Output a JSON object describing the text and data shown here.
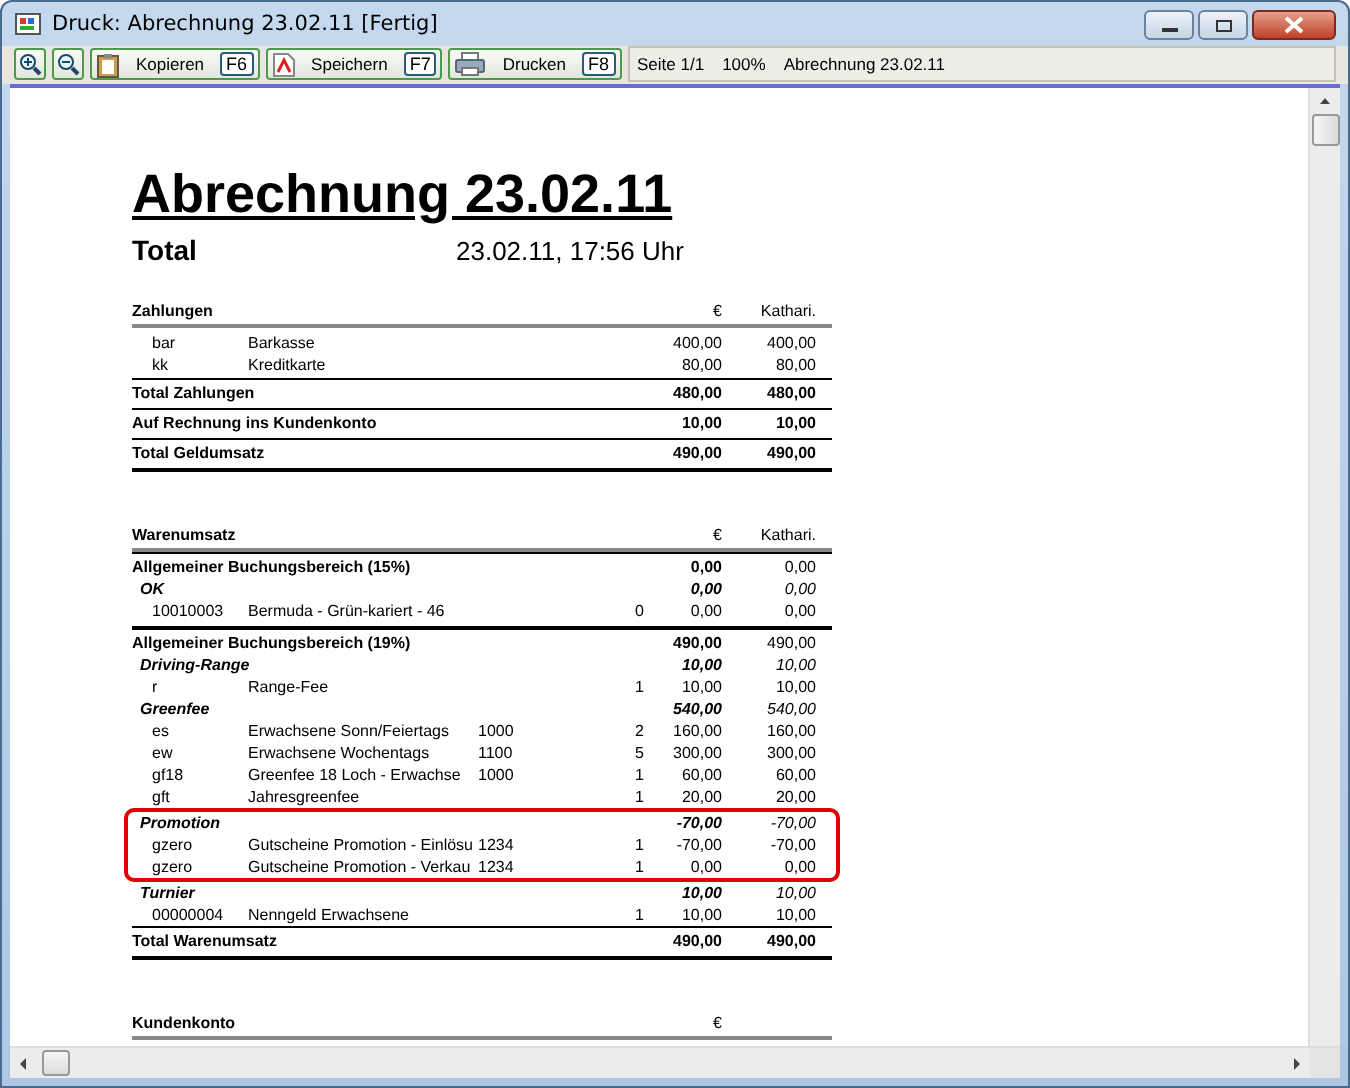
{
  "window": {
    "title": "Druck: Abrechnung 23.02.11 [Fertig]"
  },
  "toolbar": {
    "buttons": [
      {
        "kind": "copy",
        "label": "Kopieren",
        "key": "F6"
      },
      {
        "kind": "save",
        "label": "Speichern",
        "key": "F7"
      },
      {
        "kind": "print",
        "label": "Drucken",
        "key": "F8"
      }
    ],
    "status": [
      "Seite 1/1",
      "100%",
      "Abrechnung 23.02.11"
    ]
  },
  "report": {
    "title": "Abrechnung 23.02.11",
    "subtitle": "Total",
    "date": "23.02.11, 17:56 Uhr",
    "sections": [
      {
        "heading": "Zahlungen",
        "columns": [
          "€",
          "Kathari."
        ],
        "items": [
          {
            "code": "bar",
            "name": "Barkasse",
            "eur": "400,00",
            "user": "400,00"
          },
          {
            "code": "kk",
            "name": "Kreditkarte",
            "eur": "80,00",
            "user": "80,00"
          }
        ],
        "totals": [
          {
            "label": "Total Zahlungen",
            "eur": "480,00",
            "user": "480,00"
          },
          {
            "label": "Auf Rechnung ins Kundenkonto",
            "eur": "10,00",
            "user": "10,00"
          },
          {
            "label": "Total Geldumsatz",
            "eur": "490,00",
            "user": "490,00"
          }
        ]
      },
      {
        "heading": "Warenumsatz",
        "columns": [
          "€",
          "Kathari."
        ],
        "groups": [
          {
            "label": "Allgemeiner Buchungsbereich (15%)",
            "eur": "0,00",
            "user": "0,00",
            "categories": [
              {
                "label": "OK",
                "eur": "0,00",
                "user": "0,00",
                "highlighted": false,
                "items": [
                  {
                    "code": "10010003",
                    "name": "Bermuda - Grün-kariert - 46",
                    "qty": "0",
                    "eur": "0,00",
                    "user": "0,00"
                  }
                ]
              }
            ]
          },
          {
            "label": "Allgemeiner Buchungsbereich (19%)",
            "eur": "490,00",
            "user": "490,00",
            "categories": [
              {
                "label": "Driving-Range",
                "eur": "10,00",
                "user": "10,00",
                "highlighted": false,
                "items": [
                  {
                    "code": "r",
                    "name": "Range-Fee",
                    "qty": "1",
                    "eur": "10,00",
                    "user": "10,00"
                  }
                ]
              },
              {
                "label": "Greenfee",
                "eur": "540,00",
                "user": "540,00",
                "highlighted": false,
                "items": [
                  {
                    "code": "es",
                    "name": "Erwachsene Sonn/Feiertags",
                    "extra": "1000",
                    "qty": "2",
                    "eur": "160,00",
                    "user": "160,00"
                  },
                  {
                    "code": "ew",
                    "name": "Erwachsene Wochentags",
                    "extra": "1100",
                    "qty": "5",
                    "eur": "300,00",
                    "user": "300,00"
                  },
                  {
                    "code": "gf18",
                    "name": "Greenfee 18 Loch - Erwachse",
                    "extra": "1000",
                    "qty": "1",
                    "eur": "60,00",
                    "user": "60,00"
                  },
                  {
                    "code": "gft",
                    "name": "Jahresgreenfee",
                    "qty": "1",
                    "eur": "20,00",
                    "user": "20,00"
                  }
                ]
              },
              {
                "label": "Promotion",
                "eur": "-70,00",
                "user": "-70,00",
                "highlighted": true,
                "items": [
                  {
                    "code": "gzero",
                    "name": "Gutscheine Promotion - Einlösu",
                    "extra": "1234",
                    "qty": "1",
                    "eur": "-70,00",
                    "user": "-70,00"
                  },
                  {
                    "code": "gzero",
                    "name": "Gutscheine Promotion - Verkau",
                    "extra": "1234",
                    "qty": "1",
                    "eur": "0,00",
                    "user": "0,00"
                  }
                ]
              },
              {
                "label": "Turnier",
                "eur": "10,00",
                "user": "10,00",
                "highlighted": false,
                "items": [
                  {
                    "code": "00000004",
                    "name": "Nenngeld Erwachsene",
                    "qty": "1",
                    "eur": "10,00",
                    "user": "10,00"
                  }
                ]
              }
            ]
          }
        ],
        "totals": [
          {
            "label": "Total Warenumsatz",
            "eur": "490,00",
            "user": "490,00"
          }
        ]
      },
      {
        "heading": "Kundenkonto",
        "columns": [
          "€"
        ]
      }
    ]
  }
}
